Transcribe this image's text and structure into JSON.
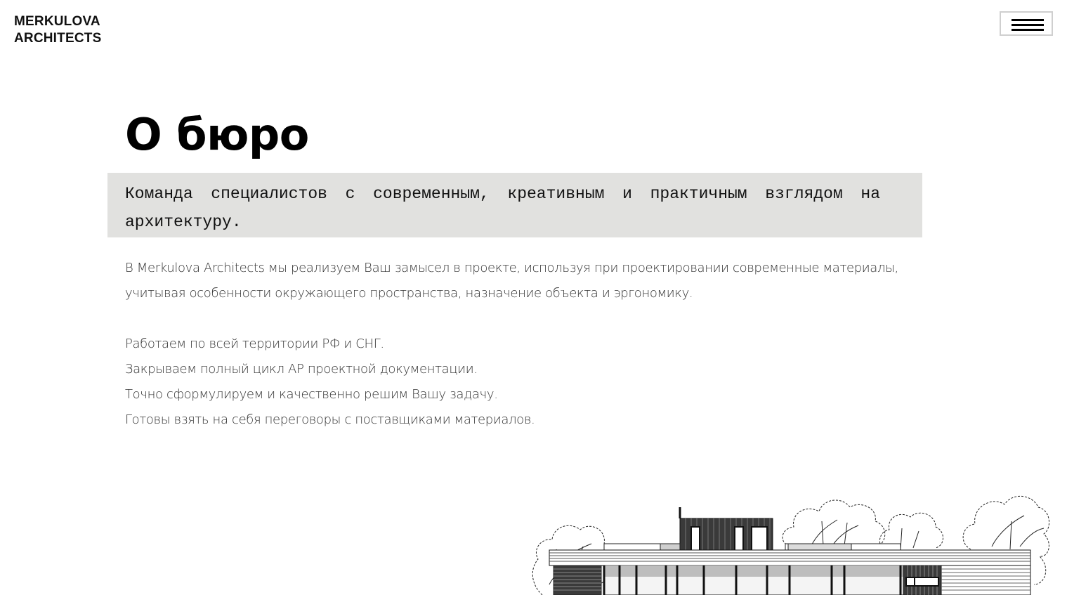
{
  "header": {
    "logo_line1": "MERKULOVA",
    "logo_line2": "ARCHITECTS",
    "menu_icon": "hamburger-menu-icon"
  },
  "main": {
    "title": "О бюро",
    "lead": "Команда специалистов с современным, креативным и практичным взглядом на архитектуру.",
    "paragraph": "В Merkulova Architects мы реализуем Ваш замысел в проекте, используя при проектировании современные материалы, учитывая особенности окружающего пространства, назначение объекта и эргономику.",
    "points": [
      "Работаем по всей территории РФ и СНГ.",
      "Закрываем полный цикл АР проектной документации.",
      "Точно сформулируем и качественно решим Вашу задачу.",
      "Готовы взять на себя переговоры с поставщиками материалов."
    ]
  },
  "colors": {
    "lead_background": "#e1e1df",
    "text": "#333333",
    "title": "#000000"
  }
}
